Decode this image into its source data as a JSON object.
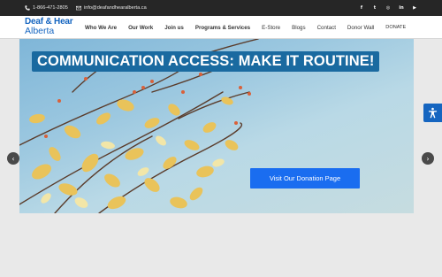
{
  "topbar": {
    "phone": "1-866-471-2805",
    "email": "info@deafandhearalberta.ca",
    "social": [
      {
        "name": "facebook-icon",
        "glyph": "f"
      },
      {
        "name": "twitter-icon",
        "glyph": "t"
      },
      {
        "name": "instagram-icon",
        "glyph": "◎"
      },
      {
        "name": "linkedin-icon",
        "glyph": "in"
      },
      {
        "name": "youtube-icon",
        "glyph": "▶"
      }
    ]
  },
  "header": {
    "logo_line1": "Deaf & Hear",
    "logo_line2": "Alberta",
    "nav": [
      "Who We Are",
      "Our Work",
      "Join us",
      "Programs & Services",
      "E-Store",
      "Blogs",
      "Contact",
      "Donor Wall",
      "DONATE"
    ]
  },
  "slider": {
    "headline": "COMMUNICATION ACCESS:  MAKE IT ROUTINE!",
    "button": "Visit Our Donation Page",
    "prev_icon": "chevron-left-icon",
    "next_icon": "chevron-right-icon"
  },
  "accessibility": {
    "icon": "accessibility-icon"
  },
  "colors": {
    "brand": "#1565c0",
    "topbar": "#262626",
    "button": "#1a6df0",
    "headline_bg": "#1a6aa0"
  }
}
